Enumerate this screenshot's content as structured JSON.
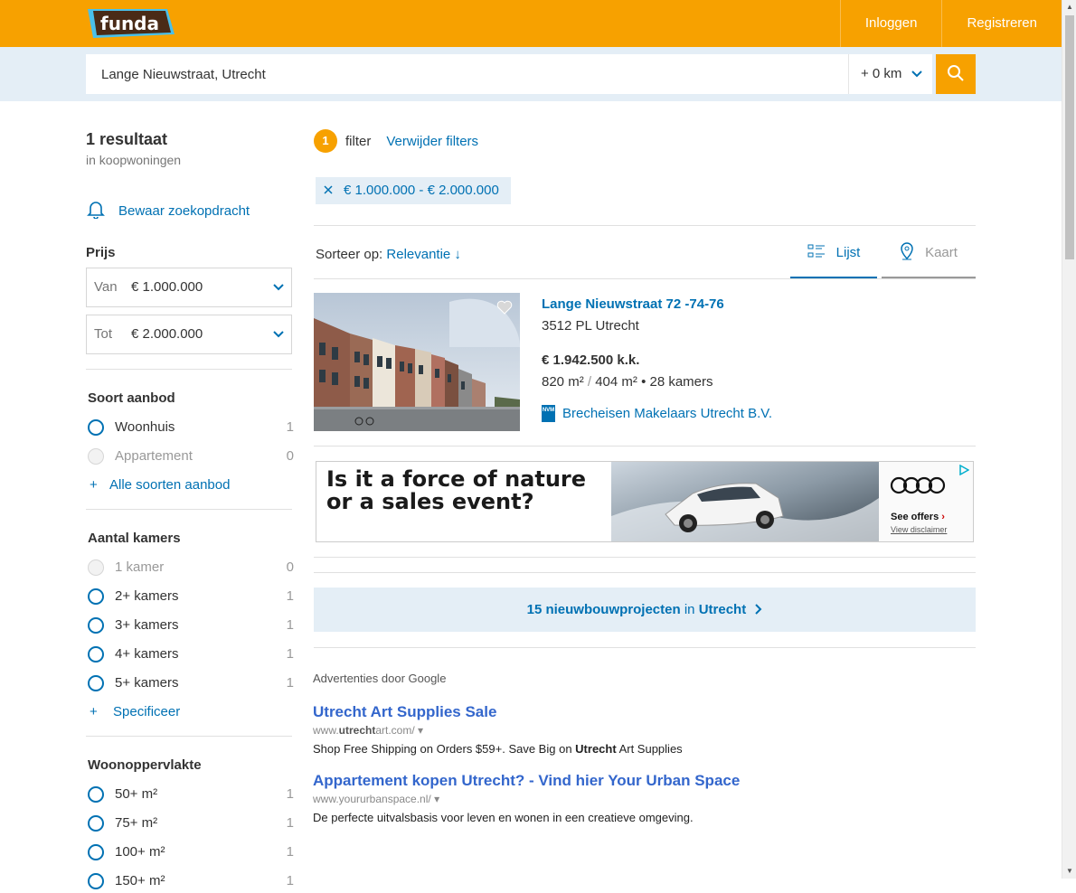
{
  "header": {
    "logo_text": "funda",
    "nav": [
      "Inloggen",
      "Registreren"
    ]
  },
  "search": {
    "value": "Lange Nieuwstraat, Utrecht",
    "radius": "+ 0 km"
  },
  "sidebar": {
    "result_count": "1 resultaat",
    "result_sub": "in koopwoningen",
    "save_search": "Bewaar zoekopdracht",
    "price_title": "Prijs",
    "price_from": {
      "label": "Van",
      "value": "€ 1.000.000"
    },
    "price_to": {
      "label": "Tot",
      "value": "€ 2.000.000"
    },
    "type_title": "Soort aanbod",
    "type_options": [
      {
        "label": "Woonhuis",
        "count": "1"
      },
      {
        "label": "Appartement",
        "count": "0"
      }
    ],
    "type_more": "Alle soorten aanbod",
    "rooms_title": "Aantal kamers",
    "room_options": [
      {
        "label": "1 kamer",
        "count": "0"
      },
      {
        "label": "2+ kamers",
        "count": "1"
      },
      {
        "label": "3+ kamers",
        "count": "1"
      },
      {
        "label": "4+ kamers",
        "count": "1"
      },
      {
        "label": "5+ kamers",
        "count": "1"
      }
    ],
    "rooms_more": "Specificeer",
    "area_title": "Woonoppervlakte",
    "area_options": [
      {
        "label": "50+ m²",
        "count": "1"
      },
      {
        "label": "75+ m²",
        "count": "1"
      },
      {
        "label": "100+ m²",
        "count": "1"
      },
      {
        "label": "150+ m²",
        "count": "1"
      }
    ]
  },
  "filters": {
    "count": "1",
    "word": "filter",
    "clear": "Verwijder filters",
    "chip": "€ 1.000.000 - € 2.000.000"
  },
  "sort": {
    "label": "Sorteer op:",
    "value": "Relevantie ↓"
  },
  "view_tabs": [
    "Lijst",
    "Kaart"
  ],
  "listing": {
    "title": "Lange Nieuwstraat 72 -74-76",
    "postcode": "3512 PL Utrecht",
    "price": "€ 1.942.500 k.k.",
    "area_living": "820 m²",
    "area_plot": "404 m²",
    "rooms": "28 kamers",
    "agent_badge": "NVM",
    "agent": "Brecheisen Makelaars Utrecht B.V."
  },
  "banner_ad": {
    "headline": "Is it a force of nature or a sales event?",
    "cta": "See offers",
    "disclaimer": "View disclaimer"
  },
  "newbuild": {
    "count_text": "15 nieuwbouwprojecten",
    "in_text": "in",
    "city": "Utrecht"
  },
  "google_ads": {
    "label": "Advertenties door Google",
    "ads": [
      {
        "title": "Utrecht Art Supplies Sale",
        "url_pre": "www.",
        "url_bold": "utrecht",
        "url_post": "art.com/",
        "desc_pre": "Shop Free Shipping on Orders $59+. Save Big on ",
        "desc_bold": "Utrecht",
        "desc_post": " Art Supplies"
      },
      {
        "title": "Appartement kopen Utrecht? - Vind hier Your Urban Space",
        "url_pre": "www.yoururbanspace.nl/",
        "url_bold": "",
        "url_post": "",
        "desc_pre": "De perfecte uitvalsbasis voor leven en wonen in een creatieve omgeving.",
        "desc_bold": "",
        "desc_post": ""
      }
    ]
  },
  "colors": {
    "brand_orange": "#f7a100",
    "link_blue": "#0071b3",
    "search_bg": "#e4eef6"
  }
}
